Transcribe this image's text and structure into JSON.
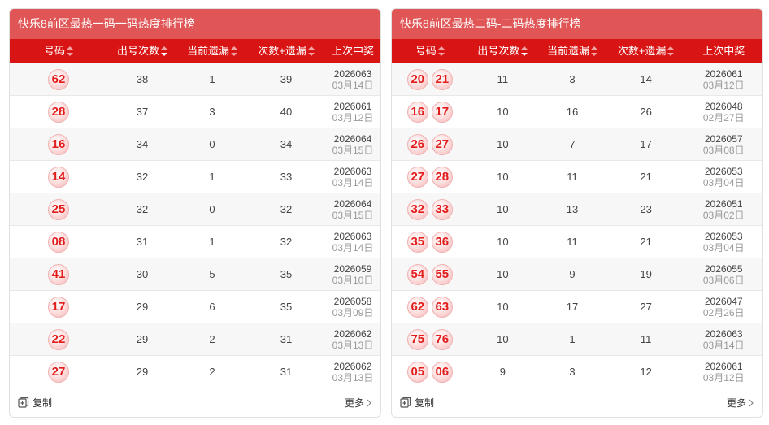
{
  "left": {
    "title": "快乐8前区最热一码一码热度排行榜",
    "headers": [
      "号码",
      "出号次数",
      "当前遗漏",
      "次数+遗漏",
      "上次中奖"
    ],
    "rows": [
      {
        "balls": [
          "62"
        ],
        "count": "38",
        "miss": "1",
        "sum": "39",
        "issue": "2026063",
        "date": "03月14日"
      },
      {
        "balls": [
          "28"
        ],
        "count": "37",
        "miss": "3",
        "sum": "40",
        "issue": "2026061",
        "date": "03月12日"
      },
      {
        "balls": [
          "16"
        ],
        "count": "34",
        "miss": "0",
        "sum": "34",
        "issue": "2026064",
        "date": "03月15日"
      },
      {
        "balls": [
          "14"
        ],
        "count": "32",
        "miss": "1",
        "sum": "33",
        "issue": "2026063",
        "date": "03月14日"
      },
      {
        "balls": [
          "25"
        ],
        "count": "32",
        "miss": "0",
        "sum": "32",
        "issue": "2026064",
        "date": "03月15日"
      },
      {
        "balls": [
          "08"
        ],
        "count": "31",
        "miss": "1",
        "sum": "32",
        "issue": "2026063",
        "date": "03月14日"
      },
      {
        "balls": [
          "41"
        ],
        "count": "30",
        "miss": "5",
        "sum": "35",
        "issue": "2026059",
        "date": "03月10日"
      },
      {
        "balls": [
          "17"
        ],
        "count": "29",
        "miss": "6",
        "sum": "35",
        "issue": "2026058",
        "date": "03月09日"
      },
      {
        "balls": [
          "22"
        ],
        "count": "29",
        "miss": "2",
        "sum": "31",
        "issue": "2026062",
        "date": "03月13日"
      },
      {
        "balls": [
          "27"
        ],
        "count": "29",
        "miss": "2",
        "sum": "31",
        "issue": "2026062",
        "date": "03月13日"
      }
    ],
    "copy_label": "复制",
    "more_label": "更多"
  },
  "right": {
    "title": "快乐8前区最热二码-二码热度排行榜",
    "headers": [
      "号码",
      "出号次数",
      "当前遗漏",
      "次数+遗漏",
      "上次中奖"
    ],
    "rows": [
      {
        "balls": [
          "20",
          "21"
        ],
        "count": "11",
        "miss": "3",
        "sum": "14",
        "issue": "2026061",
        "date": "03月12日"
      },
      {
        "balls": [
          "16",
          "17"
        ],
        "count": "10",
        "miss": "16",
        "sum": "26",
        "issue": "2026048",
        "date": "02月27日"
      },
      {
        "balls": [
          "26",
          "27"
        ],
        "count": "10",
        "miss": "7",
        "sum": "17",
        "issue": "2026057",
        "date": "03月08日"
      },
      {
        "balls": [
          "27",
          "28"
        ],
        "count": "10",
        "miss": "11",
        "sum": "21",
        "issue": "2026053",
        "date": "03月04日"
      },
      {
        "balls": [
          "32",
          "33"
        ],
        "count": "10",
        "miss": "13",
        "sum": "23",
        "issue": "2026051",
        "date": "03月02日"
      },
      {
        "balls": [
          "35",
          "36"
        ],
        "count": "10",
        "miss": "11",
        "sum": "21",
        "issue": "2026053",
        "date": "03月04日"
      },
      {
        "balls": [
          "54",
          "55"
        ],
        "count": "10",
        "miss": "9",
        "sum": "19",
        "issue": "2026055",
        "date": "03月06日"
      },
      {
        "balls": [
          "62",
          "63"
        ],
        "count": "10",
        "miss": "17",
        "sum": "27",
        "issue": "2026047",
        "date": "02月26日"
      },
      {
        "balls": [
          "75",
          "76"
        ],
        "count": "10",
        "miss": "1",
        "sum": "11",
        "issue": "2026063",
        "date": "03月14日"
      },
      {
        "balls": [
          "05",
          "06"
        ],
        "count": "9",
        "miss": "3",
        "sum": "12",
        "issue": "2026061",
        "date": "03月12日"
      }
    ],
    "copy_label": "复制",
    "more_label": "更多"
  },
  "colors": {
    "title_bg": "#e05656",
    "header_bg": "#d91414",
    "ball_text": "#e31c1c"
  }
}
